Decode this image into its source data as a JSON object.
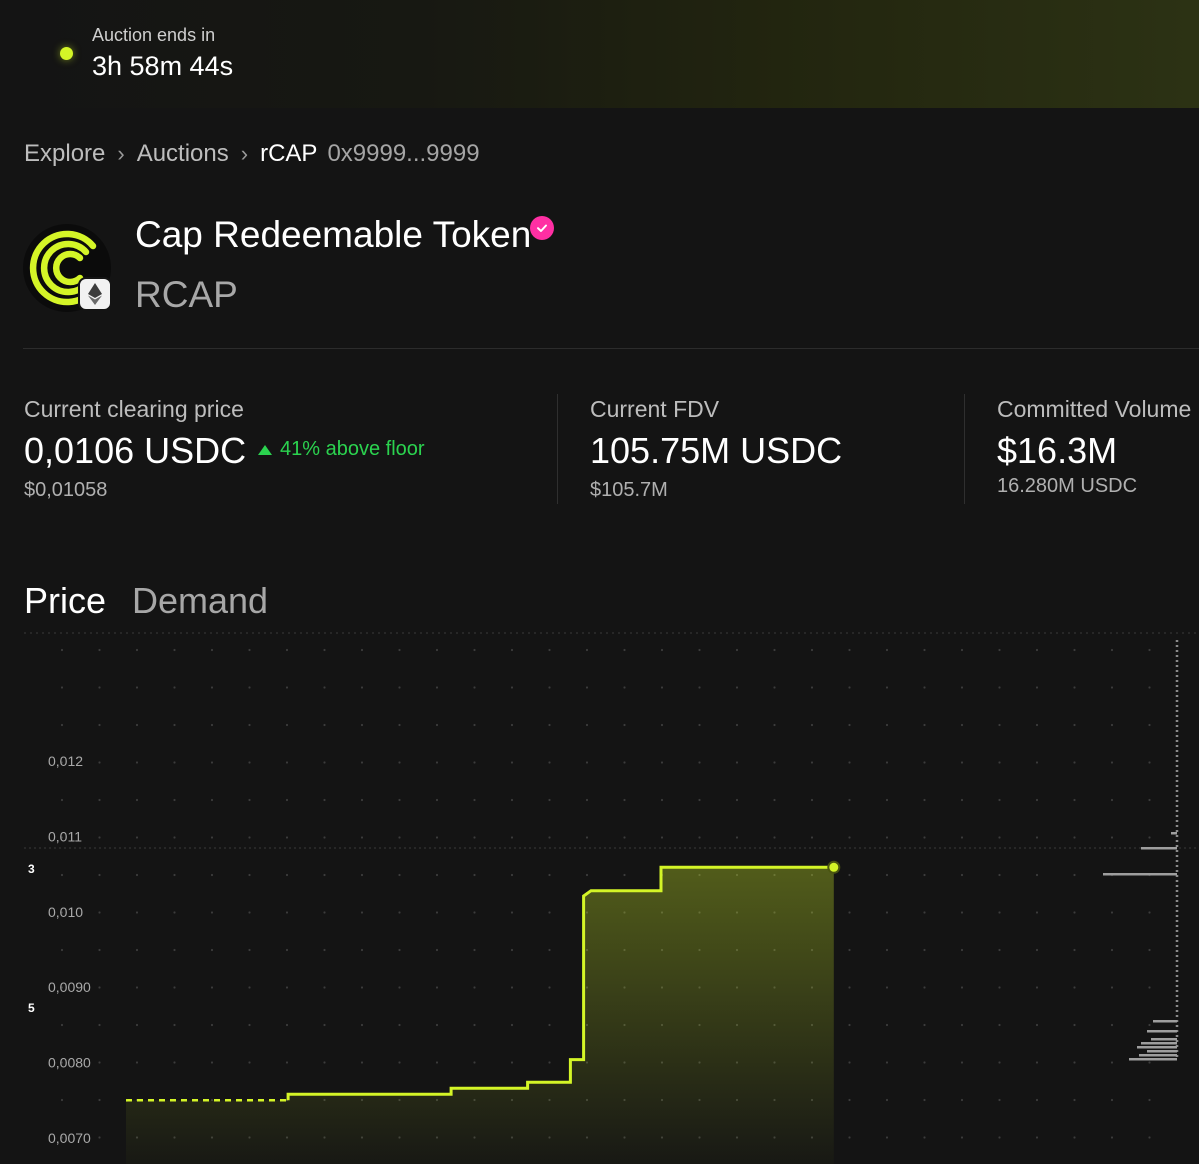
{
  "banner": {
    "label": "Auction ends in",
    "countdown": "3h 58m 44s",
    "accent": "#d4f527"
  },
  "breadcrumb": {
    "items": [
      "Explore",
      "Auctions"
    ],
    "current": "rCAP",
    "address": "0x9999...9999"
  },
  "token": {
    "name": "Cap Redeemable Token",
    "symbol": "RCAP",
    "verified_icon": "verified-check-icon",
    "chain_icon": "ethereum-icon"
  },
  "stats": {
    "clearing": {
      "label": "Current clearing price",
      "value": "0,0106 USDC",
      "change": "41% above floor",
      "sub": "$0,01058"
    },
    "fdv": {
      "label": "Current FDV",
      "value": "105.75M USDC",
      "sub": "$105.7M"
    },
    "volume": {
      "label": "Committed Volume",
      "value": "$16.3M",
      "sub": "16.280M USDC"
    }
  },
  "tabs": {
    "price": "Price",
    "demand": "Demand"
  },
  "chart_data": {
    "type": "line",
    "y_ticks": [
      "0,012",
      "0,011",
      "0,010",
      "0,0090",
      "0,0080",
      "0,0070"
    ],
    "ylim": [
      0.007,
      0.0128
    ],
    "markers": [
      "3",
      "5"
    ],
    "series": [
      {
        "color": "#d4f527",
        "floor": 0.0075,
        "points": [
          [
            0,
            0.0075
          ],
          [
            0.197,
            0.0075
          ],
          [
            0.197,
            0.00758
          ],
          [
            0.395,
            0.00758
          ],
          [
            0.395,
            0.00766
          ],
          [
            0.488,
            0.00766
          ],
          [
            0.488,
            0.00774
          ],
          [
            0.54,
            0.00774
          ],
          [
            0.54,
            0.00804
          ],
          [
            0.556,
            0.00804
          ],
          [
            0.556,
            0.01021
          ],
          [
            0.565,
            0.01028
          ],
          [
            0.65,
            0.01028
          ],
          [
            0.65,
            0.01059
          ],
          [
            0.86,
            0.01059
          ]
        ]
      }
    ],
    "grid": true
  }
}
